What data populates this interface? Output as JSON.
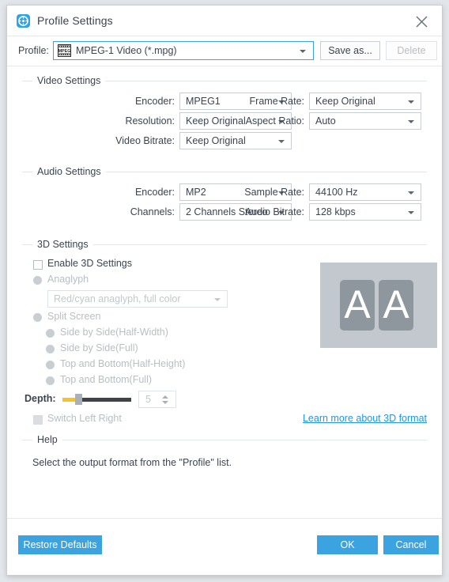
{
  "window": {
    "title": "Profile Settings",
    "app_icon": "film-reel-icon",
    "close_icon": "close-icon"
  },
  "profile_bar": {
    "label": "Profile:",
    "selected": "MPEG-1 Video (*.mpg)",
    "icon": "mpeg-film-icon",
    "save_as_label": "Save as...",
    "delete_label": "Delete"
  },
  "video_settings": {
    "title": "Video Settings",
    "fields": [
      {
        "label": "Encoder:",
        "value": "MPEG1"
      },
      {
        "label": "Resolution:",
        "value": "Keep Original"
      },
      {
        "label": "Video Bitrate:",
        "value": "Keep Original"
      },
      {
        "label": "Frame Rate:",
        "value": "Keep Original"
      },
      {
        "label": "Aspect Ratio:",
        "value": "Auto"
      }
    ]
  },
  "audio_settings": {
    "title": "Audio Settings",
    "fields": [
      {
        "label": "Encoder:",
        "value": "MP2"
      },
      {
        "label": "Channels:",
        "value": "2 Channels Stereo"
      },
      {
        "label": "Sample Rate:",
        "value": "44100 Hz"
      },
      {
        "label": "Audio Bitrate:",
        "value": "128 kbps"
      }
    ]
  },
  "three_d_settings": {
    "title": "3D Settings",
    "enable_label": "Enable 3D Settings",
    "enable_checked": false,
    "anaglyph_label": "Anaglyph",
    "anaglyph_value": "Red/cyan anaglyph, full color",
    "split_screen_label": "Split Screen",
    "split_options": [
      "Side by Side(Half-Width)",
      "Side by Side(Full)",
      "Top and Bottom(Half-Height)",
      "Top and Bottom(Full)"
    ],
    "depth_label": "Depth:",
    "depth_value": "5",
    "switch_left_right_label": "Switch Left Right",
    "learn_more_label": "Learn more about 3D format",
    "preview_letter_left": "A",
    "preview_letter_right": "A"
  },
  "help": {
    "title": "Help",
    "text": "Select the output format from the \"Profile\" list."
  },
  "footer": {
    "restore_label": "Restore Defaults",
    "ok_label": "OK",
    "cancel_label": "Cancel"
  },
  "colors": {
    "accent": "#3ba3e0",
    "link": "#2196e3",
    "slider_fill": "#f5c328",
    "slider_track": "#3d4349",
    "preview_bg": "#c3c8cf",
    "preview_block": "#8e979e"
  }
}
